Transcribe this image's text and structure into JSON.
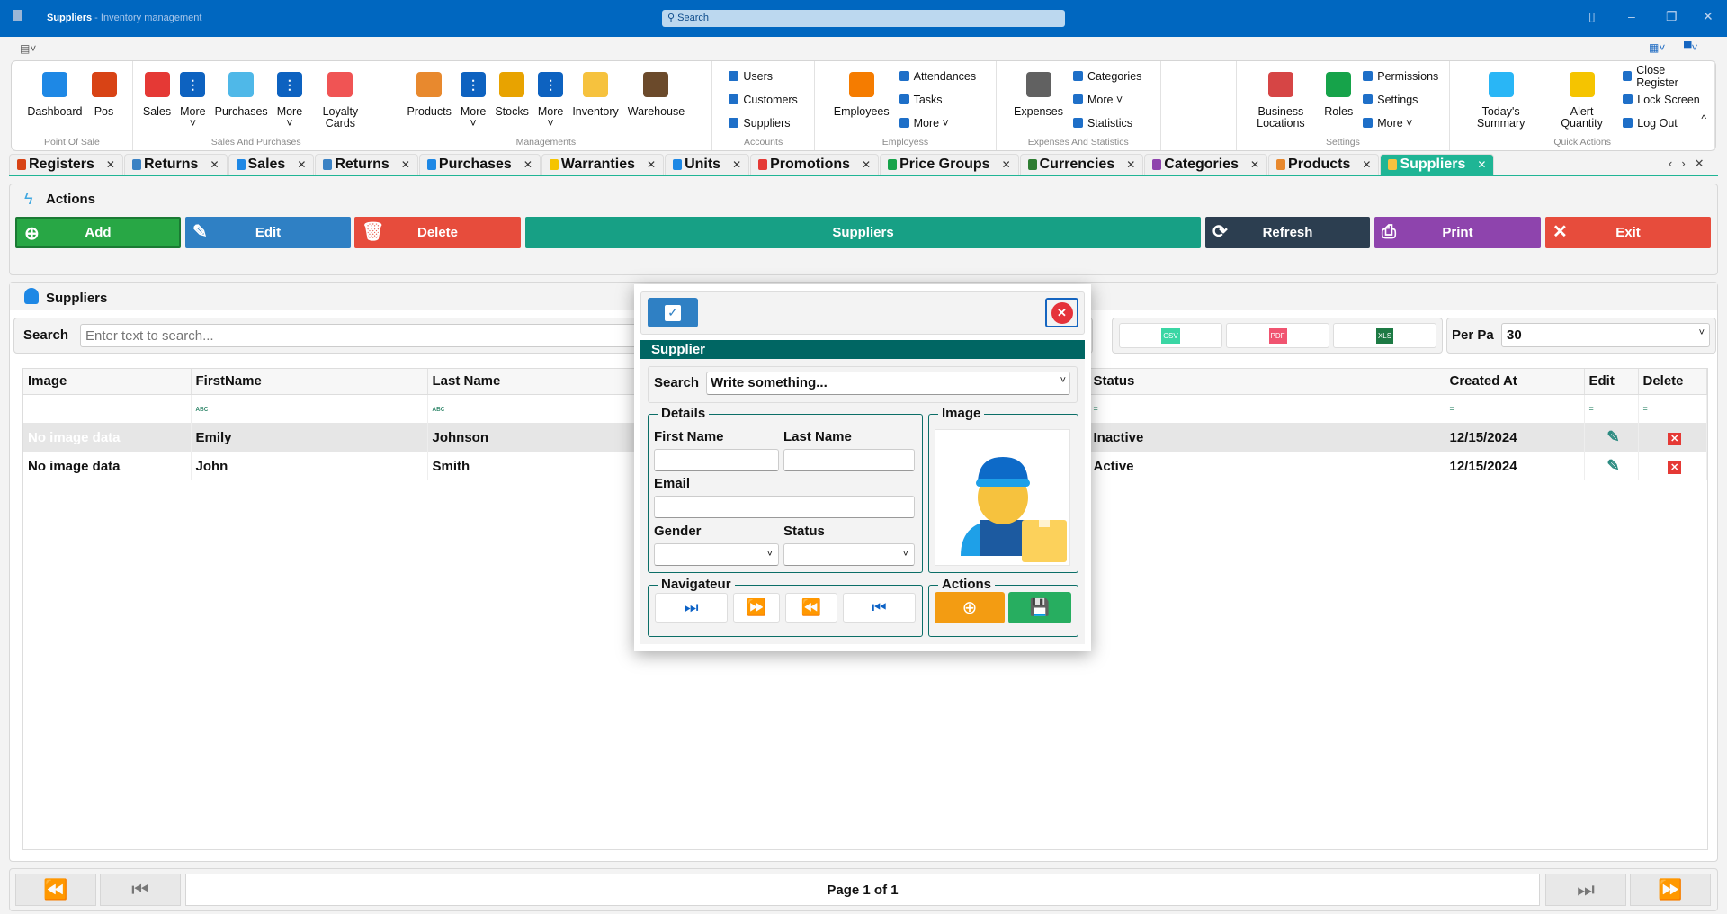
{
  "window": {
    "title": "Suppliers",
    "subtitle": " - Inventory management",
    "search_placeholder": "Search"
  },
  "ribbon": {
    "groups": [
      {
        "label": "Point Of Sale",
        "items": [
          {
            "label": "Dashboard",
            "color": "#1e88e5"
          },
          {
            "label": "Pos",
            "color": "#d84315"
          }
        ]
      },
      {
        "label": "Sales And Purchases",
        "items": [
          {
            "label": "Sales",
            "color": "#e53935"
          },
          {
            "label": "More",
            "color": "#0d62c0"
          },
          {
            "label": "Purchases",
            "color": "#4fb8e8"
          },
          {
            "label": "More",
            "color": "#0d62c0"
          },
          {
            "label": "Loyalty Cards",
            "color": "#f05454"
          }
        ]
      },
      {
        "label": "Managements",
        "items": [
          {
            "label": "Products",
            "color": "#e8892e"
          },
          {
            "label": "More",
            "color": "#0d62c0"
          },
          {
            "label": "Stocks",
            "color": "#e8a300"
          },
          {
            "label": "More",
            "color": "#0d62c0"
          },
          {
            "label": "Inventory",
            "color": "#f6c23e"
          },
          {
            "label": "Warehouse",
            "color": "#6b4a2b"
          }
        ]
      },
      {
        "label": "Accounts",
        "small": [
          "Users",
          "Customers",
          "Suppliers"
        ]
      },
      {
        "label": "Employess",
        "items": [
          {
            "label": "Employees",
            "color": "#f57c00"
          }
        ],
        "small": [
          "Attendances",
          "Tasks",
          "More ˅"
        ]
      },
      {
        "label": "Expenses And Statistics",
        "items": [
          {
            "label": "Expenses",
            "color": "#616161"
          }
        ],
        "small": [
          "Categories",
          "More ˅",
          "Statistics"
        ]
      },
      {
        "label": "",
        "items": []
      },
      {
        "label": "Settings",
        "items": [
          {
            "label": "Business Locations",
            "color": "#d64545"
          },
          {
            "label": "Roles",
            "color": "#16a34a"
          }
        ],
        "small": [
          "Permissions",
          "Settings",
          "More ˅"
        ]
      },
      {
        "label": "Quick Actions",
        "items": [
          {
            "label": "Today's Summary",
            "color": "#29b6f6"
          },
          {
            "label": "Alert Quantity",
            "color": "#f5c400"
          }
        ],
        "small": [
          "Close Register",
          "Lock Screen",
          "Log Out"
        ]
      }
    ]
  },
  "tabs": [
    {
      "label": "Registers",
      "color": "#d84315"
    },
    {
      "label": "Returns",
      "color": "#3b82c4"
    },
    {
      "label": "Sales",
      "color": "#1e88e5"
    },
    {
      "label": "Returns",
      "color": "#3b82c4"
    },
    {
      "label": "Purchases",
      "color": "#1e88e5"
    },
    {
      "label": "Warranties",
      "color": "#f5c400"
    },
    {
      "label": "Units",
      "color": "#1e88e5"
    },
    {
      "label": "Promotions",
      "color": "#e53935"
    },
    {
      "label": "Price Groups",
      "color": "#16a34a"
    },
    {
      "label": "Currencies",
      "color": "#2e7d32"
    },
    {
      "label": "Categories",
      "color": "#8e44ad"
    },
    {
      "label": "Products",
      "color": "#e8892e"
    },
    {
      "label": "Suppliers",
      "color": "#f6c23e",
      "active": true
    }
  ],
  "actions": {
    "title": "Actions",
    "buttons": [
      {
        "label": "Add",
        "color": "#28a745",
        "icon": "⊕"
      },
      {
        "label": "Edit",
        "color": "#2f80c4",
        "icon": "✎"
      },
      {
        "label": "Delete",
        "color": "#e74c3c",
        "icon": "🗑"
      },
      {
        "label": "Suppliers",
        "color": "#17a085",
        "icon": ""
      },
      {
        "label": "Refresh",
        "color": "#2c3e50",
        "icon": "⟳"
      },
      {
        "label": "Print",
        "color": "#8e44ad",
        "icon": "⎙"
      },
      {
        "label": "Exit",
        "color": "#e74c3c",
        "icon": "✕"
      }
    ]
  },
  "suppliers": {
    "title": "Suppliers",
    "search_label": "Search",
    "search_placeholder": "Enter text to search...",
    "export": [
      "CSV",
      "PDF",
      "XLS"
    ],
    "per_page_label": "Per Pa",
    "per_page": "30",
    "columns": [
      "Image",
      "FirstName",
      "Last Name",
      "Status",
      "Created At",
      "Edit",
      "Delete"
    ],
    "filter_row": [
      "",
      "ᴀʙc",
      "ᴀʙc",
      "=",
      "=",
      "=",
      "="
    ],
    "rows": [
      {
        "image": "No image data",
        "first": "Emily",
        "last": "Johnson",
        "status": "Inactive",
        "created": "12/15/2024"
      },
      {
        "image": "No image data",
        "first": "John",
        "last": "Smith",
        "status": "Active",
        "created": "12/15/2024"
      }
    ]
  },
  "pager": {
    "text": "Page 1 of 1"
  },
  "dialog": {
    "title": "Supplier",
    "search_label": "Search",
    "search_placeholder": "Write something...",
    "details_label": "Details",
    "first_name": "First Name",
    "last_name": "Last Name",
    "email": "Email",
    "gender": "Gender",
    "status": "Status",
    "image_label": "Image",
    "nav_label": "Navigateur",
    "actions_label": "Actions",
    "header_color": "#006663"
  }
}
